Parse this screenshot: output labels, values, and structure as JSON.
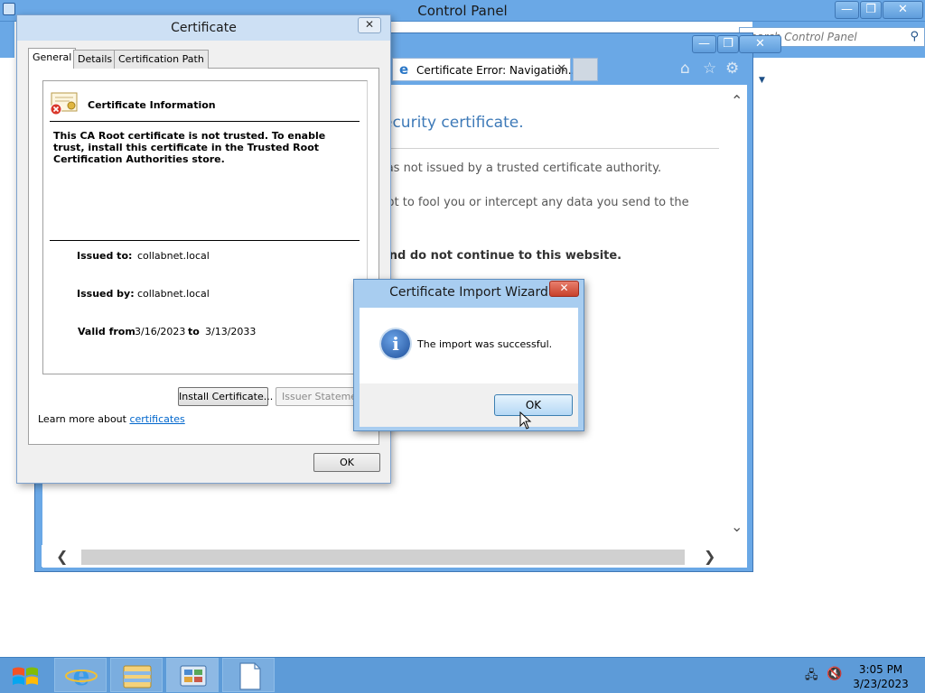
{
  "control_panel": {
    "title": "Control Panel",
    "search_placeholder": "Search Control Panel"
  },
  "ie": {
    "tab_title": "Certificate Error: Navigation...",
    "content": {
      "heading_fragment": "ecurity certificate.",
      "line1_fragment": "vas not issued by a trusted certificate authority.",
      "line2_fragment": "npt to fool you or intercept any data you send to the",
      "line3_fragment": "and do not continue to this website."
    }
  },
  "certificate_dialog": {
    "title": "Certificate",
    "tabs": [
      "General",
      "Details",
      "Certification Path"
    ],
    "info_title": "Certificate Information",
    "warning": "This CA Root certificate is not trusted. To enable trust, install this certificate in the Trusted Root Certification Authorities store.",
    "issued_to_label": "Issued to:",
    "issued_to_value": "collabnet.local",
    "issued_by_label": "Issued by:",
    "issued_by_value": "collabnet.local",
    "valid_from_label": "Valid from",
    "valid_from_value": "3/16/2023",
    "valid_to_label": "to",
    "valid_to_value": "3/13/2033",
    "install_button": "Install Certificate...",
    "issuer_statement_button": "Issuer Statement",
    "learn_more_text": "Learn more about",
    "learn_more_link": "certificates",
    "ok_button": "OK"
  },
  "import_wizard": {
    "title": "Certificate Import Wizard",
    "message": "The import was successful.",
    "ok_button": "OK",
    "icon": "info-icon"
  },
  "taskbar": {
    "time": "3:05 PM",
    "date": "3/23/2023",
    "apps": [
      "internet-explorer",
      "file-explorer",
      "control-panel",
      "notepad"
    ]
  },
  "colors": {
    "accent": "#6aa8e6",
    "taskbar": "#5d9bd8",
    "link": "#0066cc",
    "close_red": "#c8412b"
  }
}
